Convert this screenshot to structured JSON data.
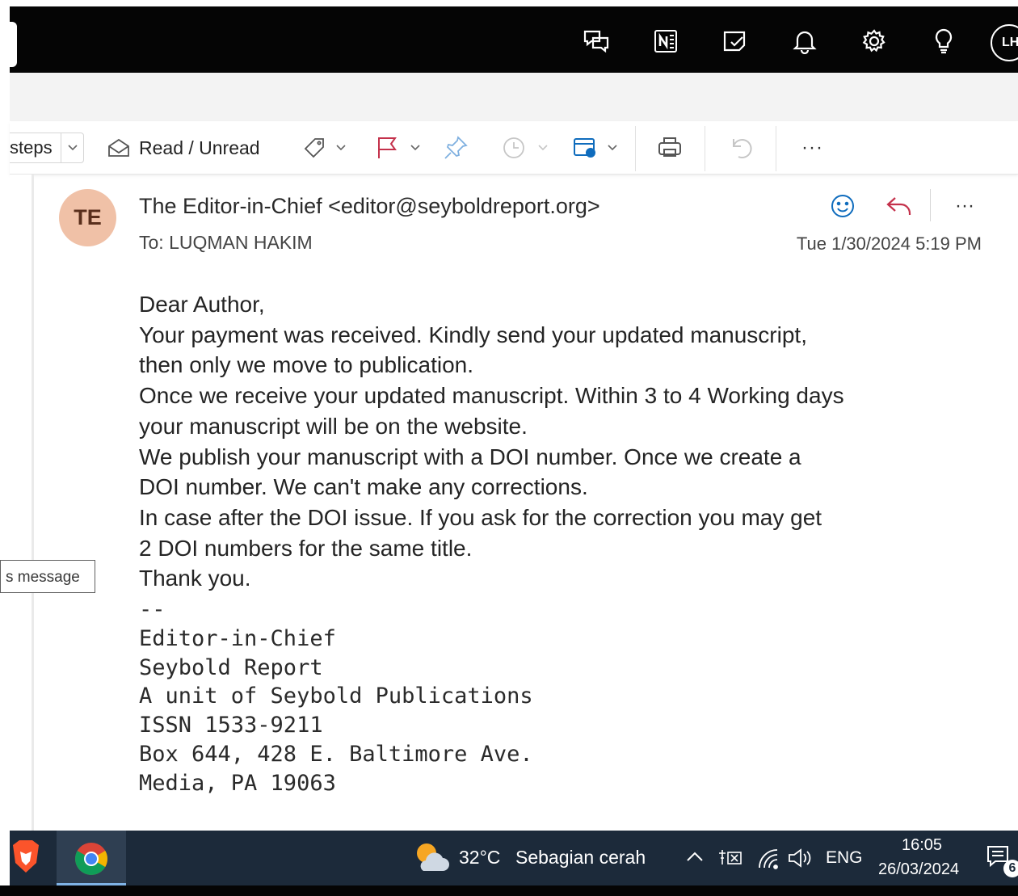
{
  "topbar": {
    "avatar_initials": "LH",
    "icons": [
      "teams-chat-icon",
      "onenote-icon",
      "my-day-icon",
      "bell-icon",
      "gear-icon",
      "lightbulb-icon"
    ]
  },
  "ribbon": {
    "steps_label": "steps",
    "read_unread_label": "Read / Unread",
    "more_label": "···"
  },
  "message": {
    "sender_initials": "TE",
    "sender": "The Editor-in-Chief <editor@seyboldreport.org>",
    "to_line": "To:  LUQMAN HAKIM",
    "date": "Tue 1/30/2024 5:19 PM",
    "more_label": "···",
    "body_lines": [
      "Dear Author,",
      "Your payment was received. Kindly send your updated manuscript,",
      "then only we move to publication.",
      "Once we receive your updated manuscript. Within 3 to 4 Working days",
      "your manuscript will be on the website.",
      "We publish your manuscript with a DOI number.  Once we create a",
      "DOI number. We can't make any corrections.",
      "In case after the DOI issue. If you ask for the correction you may get",
      "2 DOI numbers for the same title.",
      "Thank you."
    ],
    "signature_lines": [
      "--",
      "Editor-in-Chief",
      "Seybold Report",
      "A unit of Seybold Publications",
      "ISSN 1533-9211",
      "Box 644, 428 E. Baltimore Ave.",
      "Media, PA 19063"
    ]
  },
  "tooltip": {
    "text": "s message"
  },
  "taskbar": {
    "weather_temp": "32°C",
    "weather_desc": "Sebagian cerah",
    "language": "ENG",
    "time": "16:05",
    "date": "26/03/2024",
    "notification_count": "6",
    "colors": {
      "background": "#1c2a3a",
      "active_app": "#2f3f52"
    }
  },
  "colors": {
    "flag": "#c4314b",
    "accent_blue": "#0f6cbd",
    "reply": "#c4314b",
    "avatar_bg": "#f0c1a7"
  }
}
